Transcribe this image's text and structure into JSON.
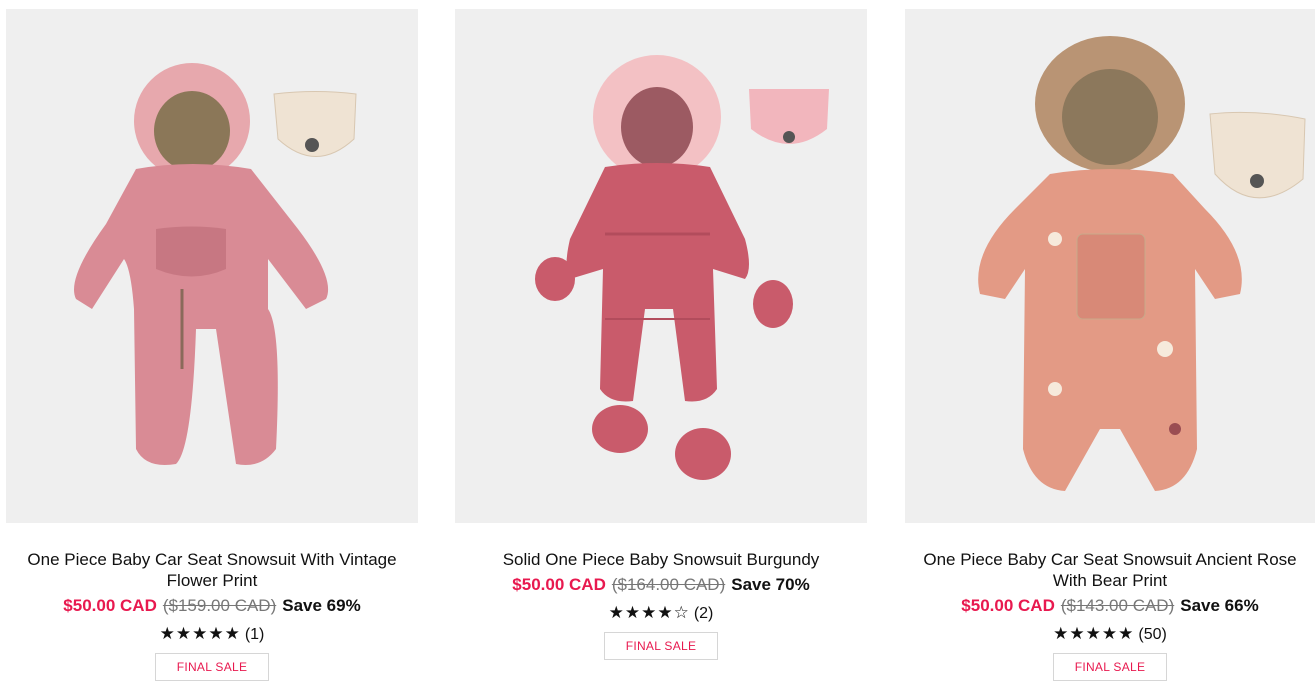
{
  "products": [
    {
      "title": "One Piece Baby Car Seat Snowsuit With Vintage Flower Print",
      "sale_price": "$50.00 CAD",
      "original_price": "($159.00 CAD)",
      "save": "Save 69%",
      "stars": "★★★★★",
      "rating_value": 5,
      "review_count": "(1)",
      "badge": "FINAL SALE",
      "image_icon": "pink-floral-snowsuit-image"
    },
    {
      "title": "Solid One Piece Baby Snowsuit Burgundy",
      "sale_price": "$50.00 CAD",
      "original_price": "($164.00 CAD)",
      "save": "Save 70%",
      "stars": "★★★★☆",
      "rating_value": 4,
      "review_count": "(2)",
      "badge": "FINAL SALE",
      "image_icon": "burgundy-snowsuit-image"
    },
    {
      "title": "One Piece Baby Car Seat Snowsuit Ancient Rose With Bear Print",
      "sale_price": "$50.00 CAD",
      "original_price": "($143.00 CAD)",
      "save": "Save 66%",
      "stars": "★★★★★",
      "rating_value": 5,
      "review_count": "(50)",
      "badge": "FINAL SALE",
      "image_icon": "rose-bear-print-snowsuit-image"
    }
  ],
  "colors": {
    "sale": "#e8194f",
    "image_bg": "#efefef"
  }
}
